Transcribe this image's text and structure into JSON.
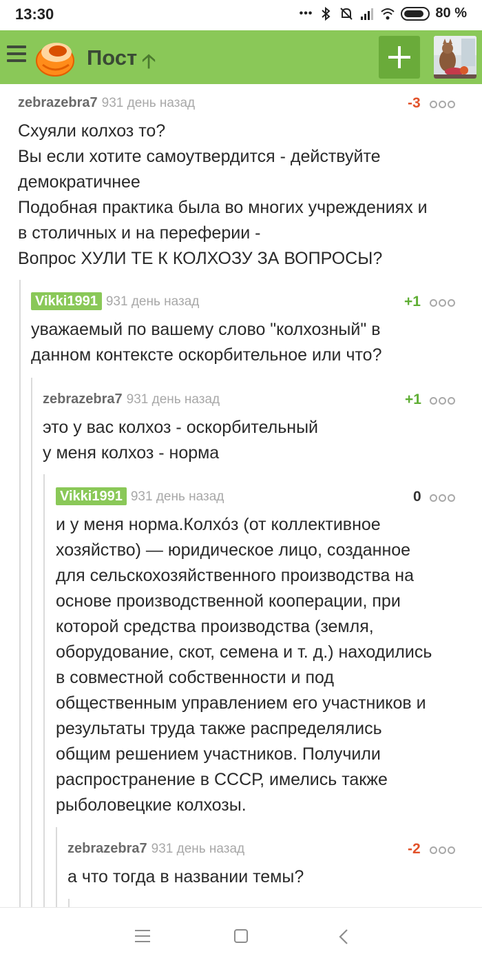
{
  "status_bar": {
    "time": "13:30",
    "dots": "•••",
    "battery": "80 %",
    "icons": [
      "bluetooth-icon",
      "mute-bell-icon",
      "signal-icon",
      "wifi-icon",
      "battery-icon"
    ]
  },
  "header": {
    "title": "Пост",
    "title_arrow": "🡡",
    "menu_icon": "hamburger-icon",
    "add_icon": "plus-icon",
    "colors": {
      "bar": "#8ac858",
      "button": "#6aab3a"
    }
  },
  "comments": [
    {
      "author": "zebrazebra7",
      "time": "931 день назад",
      "rating": "-3",
      "lines": [
        "Схуяли колхоз то?",
        "Вы если хотите самоутвердится - действуйте",
        "демократичнее",
        "Подобная практика была во многих учреждениях и",
        "в столичных и на переферии -",
        "Вопрос ХУЛИ ТЕ К КОЛХОЗУ ЗА ВОПРОСЫ?"
      ]
    },
    {
      "author": "Vikki1991",
      "time": "931 день назад",
      "rating": "+1",
      "lines": [
        "уважаемый по вашему слово \"колхозный\" в",
        "данном контексте оскорбительное или что?"
      ]
    },
    {
      "author": "zebrazebra7",
      "time": "931 день назад",
      "rating": "+1",
      "lines": [
        "это у вас колхоз - оскорбительный",
        "у меня колхоз - норма"
      ]
    },
    {
      "author": "Vikki1991",
      "time": "931 день назад",
      "rating": "0",
      "lines": [
        "и у меня норма.Колхо́з (от коллективное",
        "хозяйство) — юридическое лицо, созданное",
        "для сельскохозяйственного производства на",
        "основе производственной кооперации, при",
        "которой средства производства (земля,",
        "оборудование, скот, семена и т. д.) находились",
        "в совместной собственности и под",
        "общественным управлением его участников и",
        "результаты труда также распределялись",
        "общим решением участников. Получили",
        "распространение в СССР, имелись также",
        "рыболовецкие колхозы."
      ]
    },
    {
      "author": "zebrazebra7",
      "time": "931 день назад",
      "rating": "-2",
      "lines": [
        "а что тогда в названии темы?"
      ]
    }
  ],
  "colors": {
    "negative": "#e2522a",
    "positive": "#5fae34",
    "author_badge": "#8ac858"
  },
  "nav_bar": {
    "icons": [
      "menu-icon",
      "home-square-icon",
      "back-chevron-icon"
    ]
  }
}
